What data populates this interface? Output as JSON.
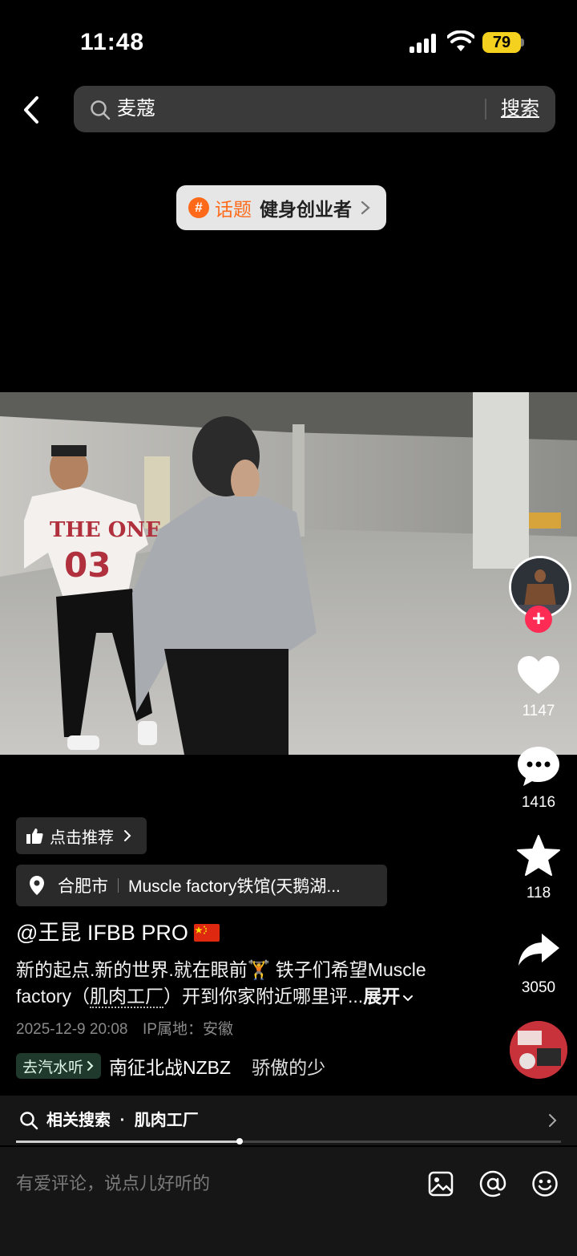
{
  "status_bar": {
    "time": "11:48",
    "battery": "79"
  },
  "search": {
    "query": "麦蔻",
    "button_label": "搜索"
  },
  "topic": {
    "label": "话题",
    "name": "健身创业者"
  },
  "side_actions": {
    "likes": "1147",
    "comments": "1416",
    "favorites": "118",
    "shares": "3050"
  },
  "recommend": {
    "label": "点击推荐"
  },
  "location": {
    "city": "合肥市",
    "place": "Muscle factory铁馆(天鹅湖..."
  },
  "post": {
    "author": "@王昆 IFBB PRO",
    "description_line1": "新的起点.新的世界.就在眼前🏋️ 铁子们希望Muscle",
    "description_line2_prefix": "factory（",
    "description_line2_link": "肌肉工厂",
    "description_line2_suffix": "）开到你家附近哪里评...",
    "expand_label": "展开",
    "date": "2025-12-9 20:08",
    "ip_location": "IP属地：安徽"
  },
  "music": {
    "chip_label": "去汽水听",
    "track": "南征北战NZBZ",
    "track_next": "骄傲的少"
  },
  "related_search": {
    "prefix": "相关搜索",
    "separator": "·",
    "term": "肌肉工厂"
  },
  "video_progress": 0.41,
  "comment_input": {
    "placeholder": "有爱评论，说点儿好听的"
  },
  "colors": {
    "accent_red": "#fe2c55",
    "topic_orange": "#ff6a1a",
    "battery_yellow": "#f4d01f"
  }
}
